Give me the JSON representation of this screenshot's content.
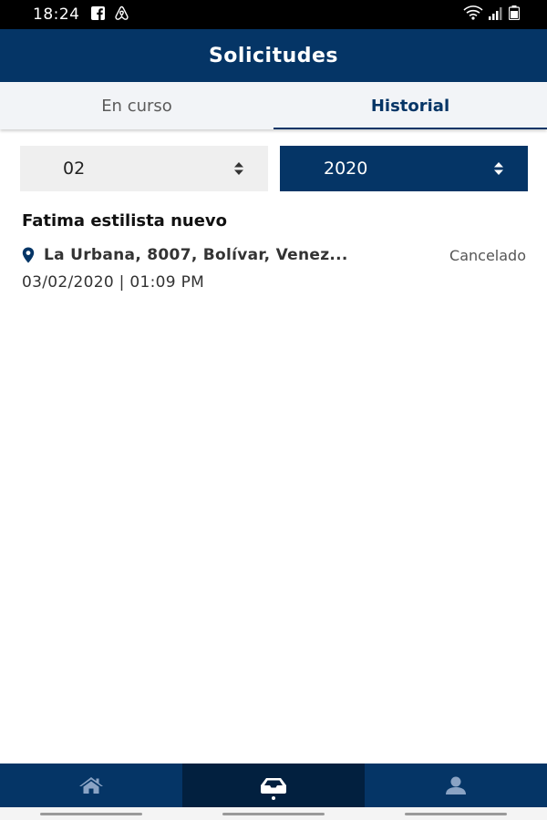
{
  "status_bar": {
    "time": "18:24",
    "left_icons": [
      "facebook-icon",
      "airbnb-icon"
    ],
    "right_icons": [
      "wifi-icon",
      "signal-icon",
      "battery-icon"
    ]
  },
  "header": {
    "title": "Solicitudes"
  },
  "tabs": [
    {
      "label": "En curso",
      "active": false
    },
    {
      "label": "Historial",
      "active": true
    }
  ],
  "filters": {
    "month": {
      "value": "02"
    },
    "year": {
      "value": "2020"
    }
  },
  "requests": [
    {
      "name": "Fatima estilista nuevo",
      "address": "La Urbana, 8007, Bolívar, Venez...",
      "status": "Cancelado",
      "datetime": "03/02/2020 | 01:09 PM"
    }
  ],
  "bottom_nav": [
    {
      "icon": "home-icon",
      "active": false
    },
    {
      "icon": "inbox-icon",
      "active": true
    },
    {
      "icon": "profile-icon",
      "active": false
    }
  ],
  "colors": {
    "primary": "#053566",
    "primary_dark": "#02203f",
    "tab_background": "#f2f4f7",
    "select_background": "#efefef"
  }
}
